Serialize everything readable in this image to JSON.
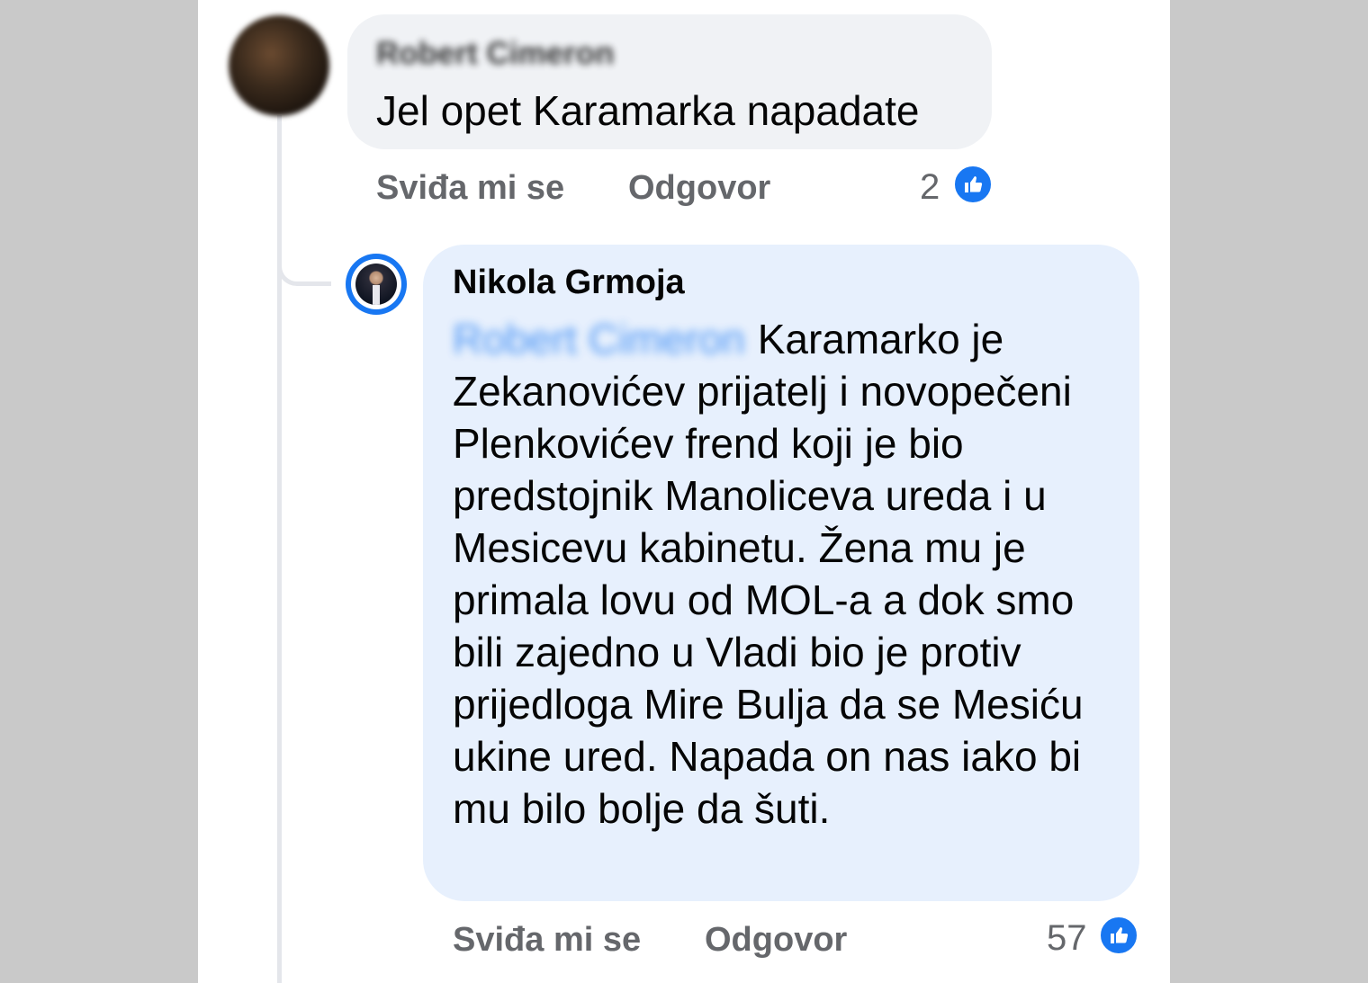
{
  "comment1": {
    "author_blurred": "Robert Cimeron",
    "text": "Jel opet Karamarka napadate",
    "actions": {
      "like": "Sviđa mi se",
      "reply": "Odgovor"
    },
    "reaction_count": "2"
  },
  "comment2": {
    "author": "Nikola Grmoja",
    "mention_blurred": "Robert Cimeron",
    "text": "Karamarko je Zekanovićev prijatelj i novopečeni Plenkovićev frend koji je bio predstojnik Manoliceva ureda i u Mesicevu kabinetu. Žena mu je primala lovu od MOL-a a dok smo bili zajedno u Vladi bio je protiv prijedloga Mire Bulja da se Mesiću ukine ured. Napada on nas iako bi mu bilo bolje da šuti.",
    "actions": {
      "like": "Sviđa mi se",
      "reply": "Odgovor"
    },
    "reaction_count": "57"
  },
  "icons": {
    "reaction": "thumbs-up-icon"
  },
  "colors": {
    "accent": "#1877f2",
    "bubble": "#f0f2f5",
    "reply_bubble": "#e7f0fd",
    "muted": "#65676b"
  }
}
